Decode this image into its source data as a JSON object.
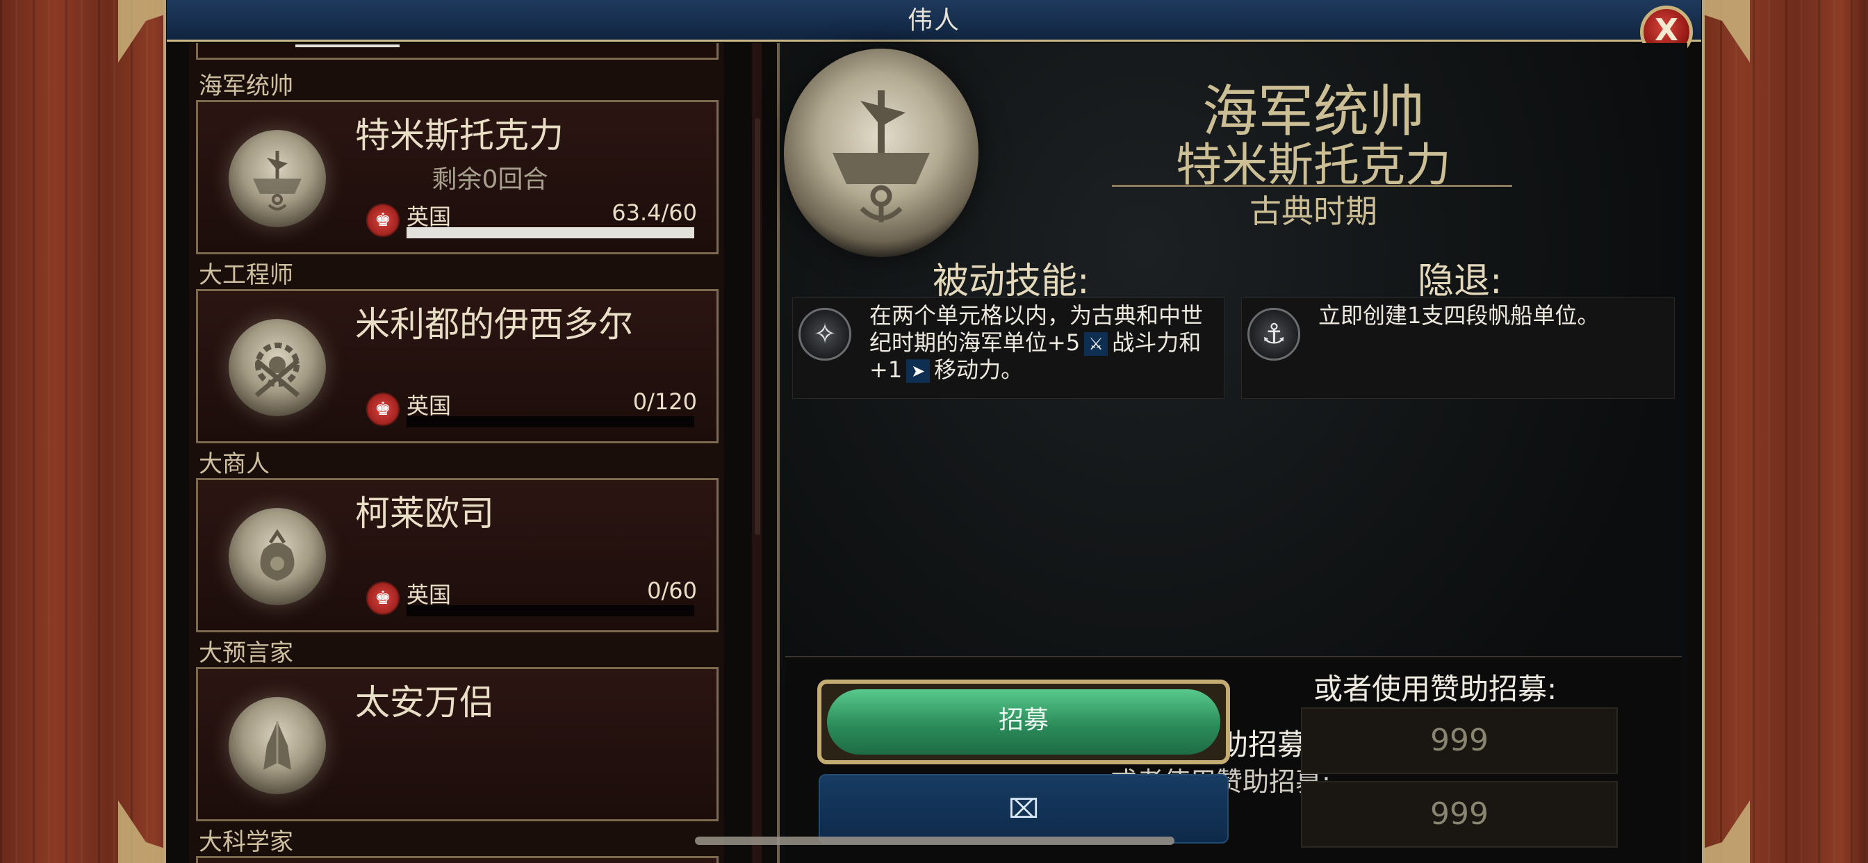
{
  "window": {
    "title": "伟人",
    "close_label": "X"
  },
  "list": {
    "items": [
      {
        "category": "海军统帅",
        "name": "特米斯托克力",
        "turns_left": "剩余0回合",
        "civ": "英国",
        "progress_text": "63.4/60",
        "progress_fraction": 1.0,
        "medal_icon": "ship-anchor-icon"
      },
      {
        "category": "大工程师",
        "name": "米利都的伊西多尔",
        "turns_left": "",
        "civ": "英国",
        "progress_text": "0/120",
        "progress_fraction": 0.0,
        "medal_icon": "gear-hammer-icon"
      },
      {
        "category": "大商人",
        "name": "柯莱欧司",
        "turns_left": "",
        "civ": "英国",
        "progress_text": "0/60",
        "progress_fraction": 0.0,
        "medal_icon": "coin-bag-icon"
      },
      {
        "category": "大预言家",
        "name": "太安万侣",
        "medal_icon": "praying-hands-icon"
      }
    ],
    "next_category": "大科学家"
  },
  "detail": {
    "role": "海军统帅",
    "name": "特米斯托克力",
    "era": "古典时期",
    "passive": {
      "title": "被动技能:",
      "text_part1": "在两个单元格以内，为古典和中世纪时期的海军单位+5",
      "text_part2": "战斗力和+1",
      "text_part3": "移动力。"
    },
    "retire": {
      "title": "隐退:",
      "text": "立即创建1支四段帆船单位。"
    }
  },
  "actions": {
    "recruit_label": "招募",
    "second_button_label": "⌧",
    "sponsor_title": "或者使用赞助招募:",
    "sponsor_label_1": "赞助招募:",
    "sponsor_label_2": "或者使用赞助招募:",
    "sponsor_value_1": "999",
    "sponsor_value_2": "999"
  },
  "colors": {
    "accent_gold": "#cdbf95",
    "recruit_green": "#2c8c5a",
    "title_blue": "#1f3a5e",
    "civ_red": "#b3241e"
  }
}
